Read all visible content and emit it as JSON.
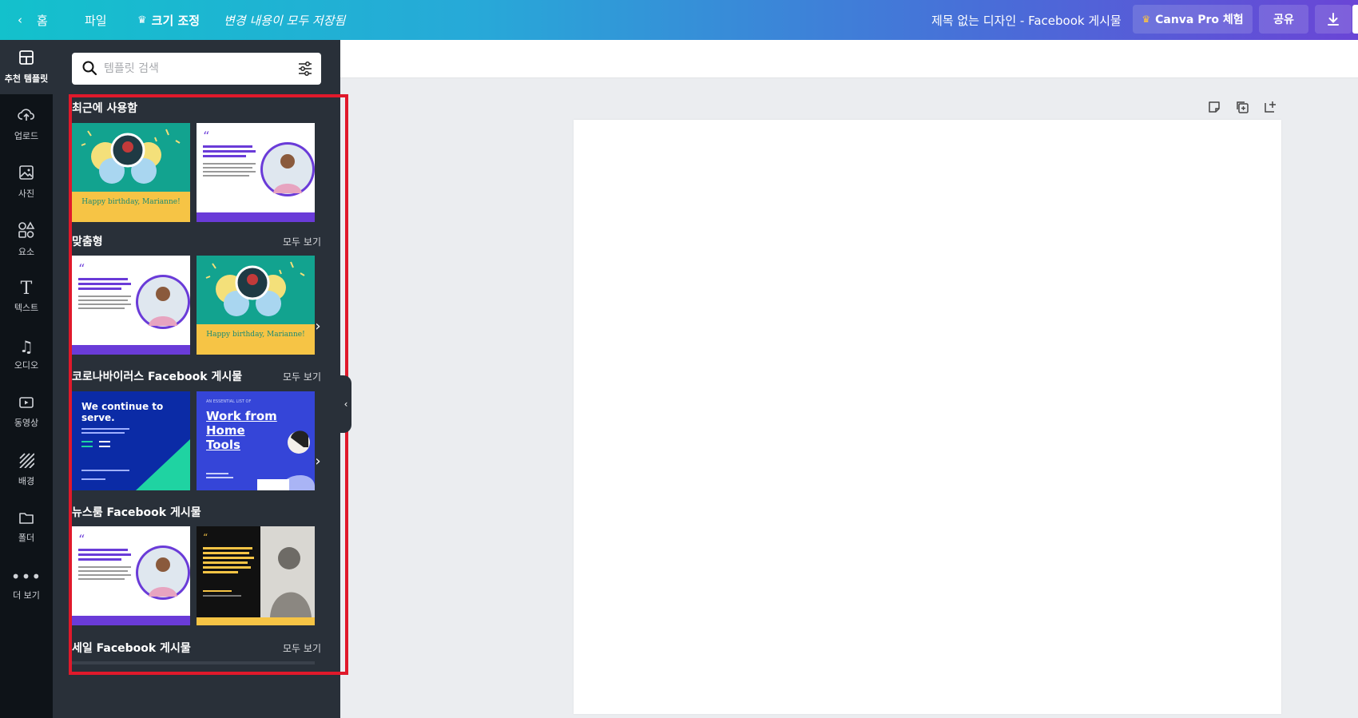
{
  "topbar": {
    "back_icon": "chevron-left-icon",
    "home_label": "홈",
    "file_label": "파일",
    "resize_label": "크기 조정",
    "saved_status": "변경 내용이 모두 저장됨",
    "design_title": "제목 없는 디자인 - Facebook 게시물",
    "pro_label": "Canva Pro 체험",
    "share_label": "공유",
    "download_icon": "download-icon"
  },
  "rail": {
    "items": [
      {
        "label": "추천 템플릿",
        "icon": "template-grid-icon"
      },
      {
        "label": "업로드",
        "icon": "upload-cloud-icon"
      },
      {
        "label": "사진",
        "icon": "photo-icon"
      },
      {
        "label": "요소",
        "icon": "shapes-icon"
      },
      {
        "label": "텍스트",
        "icon": "text-icon"
      },
      {
        "label": "오디오",
        "icon": "music-note-icon"
      },
      {
        "label": "동영상",
        "icon": "video-icon"
      },
      {
        "label": "배경",
        "icon": "background-hatch-icon"
      },
      {
        "label": "폴더",
        "icon": "folder-icon"
      },
      {
        "label": "더 보기",
        "icon": "more-dots-icon"
      }
    ]
  },
  "panel": {
    "search_placeholder": "템플릿 검색",
    "see_all_label": "모두 보기",
    "sections": [
      {
        "title": "최근에 사용함"
      },
      {
        "title": "맞춤형"
      },
      {
        "title": "코로나바이러스 Facebook 게시물"
      },
      {
        "title": "뉴스룸 Facebook 게시물"
      },
      {
        "title": "세일 Facebook 게시물"
      }
    ],
    "thumb_text": {
      "birthday": "Happy birthday, Marianne!",
      "corona_headline": "We continue to serve.",
      "work_from_home": "Work from Home Tools",
      "essential_list": "AN ESSENTIAL LIST OF"
    }
  },
  "colors": {
    "highlight": "#e0192b",
    "panel_bg": "#293039",
    "rail_bg": "#0e1318",
    "gradient_start": "#13c1cc",
    "gradient_end": "#6a45d6"
  }
}
